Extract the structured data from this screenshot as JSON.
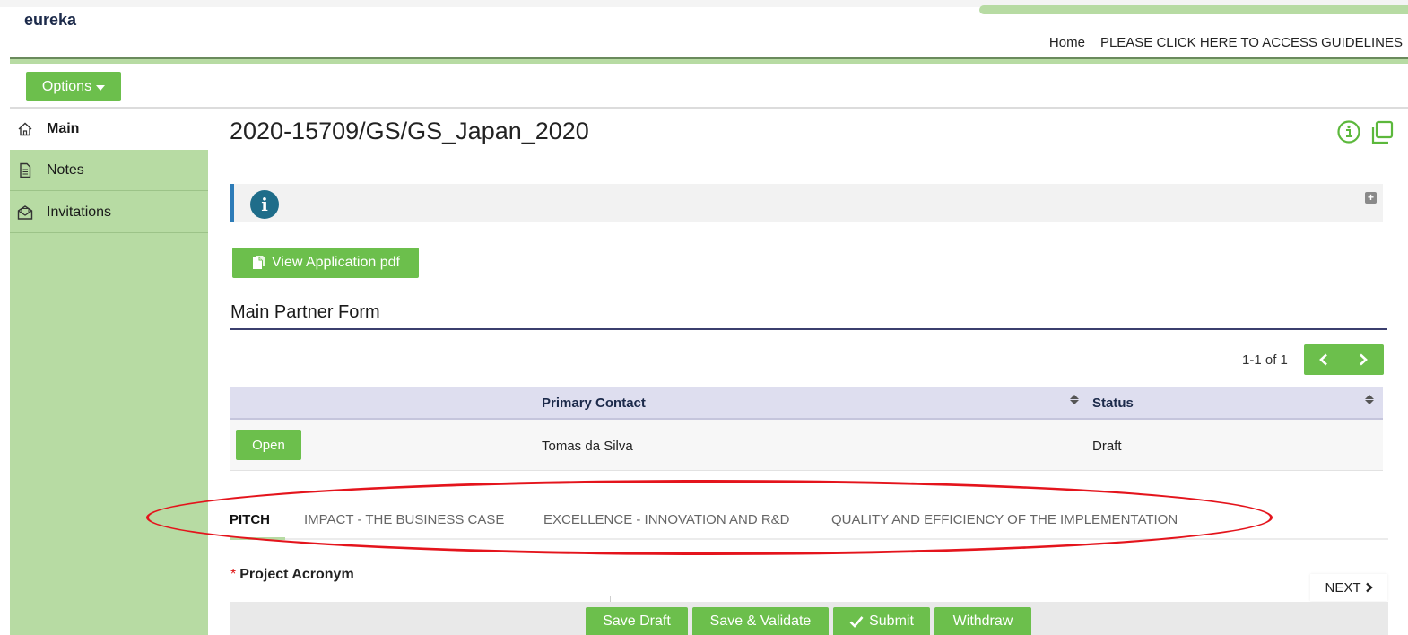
{
  "brand": {
    "name": "eureka"
  },
  "topnav": {
    "home": "Home",
    "guidelines": "PLEASE CLICK HERE TO ACCESS GUIDELINES"
  },
  "options": {
    "label": "Options"
  },
  "sidebar": {
    "items": [
      {
        "label": "Main",
        "icon": "home-icon",
        "active": true
      },
      {
        "label": "Notes",
        "icon": "document-icon",
        "active": false
      },
      {
        "label": "Invitations",
        "icon": "envelope-icon",
        "active": false
      }
    ]
  },
  "page": {
    "title": "2020-15709/GS/GS_Japan_2020"
  },
  "info": {
    "icon": "info-icon"
  },
  "pdf_button": {
    "label": "View Application pdf"
  },
  "section": {
    "title": "Main Partner Form"
  },
  "pager": {
    "text": "1-1 of 1"
  },
  "table": {
    "columns": [
      "Primary Contact",
      "Status"
    ],
    "rows": [
      {
        "action": "Open",
        "primary_contact": "Tomas da Silva",
        "status": "Draft"
      }
    ]
  },
  "tabs": [
    {
      "label": "PITCH",
      "active": true
    },
    {
      "label": "IMPACT - THE BUSINESS CASE",
      "active": false
    },
    {
      "label": "EXCELLENCE - INNOVATION AND R&D",
      "active": false
    },
    {
      "label": "QUALITY AND EFFICIENCY OF THE IMPLEMENTATION",
      "active": false
    }
  ],
  "form": {
    "required_mark": "*",
    "project_acronym_label": "Project Acronym"
  },
  "next": {
    "label": "NEXT"
  },
  "actions": {
    "save_draft": "Save Draft",
    "save_validate": "Save & Validate",
    "submit": "Submit",
    "withdraw": "Withdraw"
  },
  "colors": {
    "brand_green": "#6cbf4c",
    "sidebar_green": "#b7dba3",
    "header_navy": "#1c2a4a",
    "highlight_red": "#e4141c",
    "info_blue": "#2e7cb8"
  }
}
